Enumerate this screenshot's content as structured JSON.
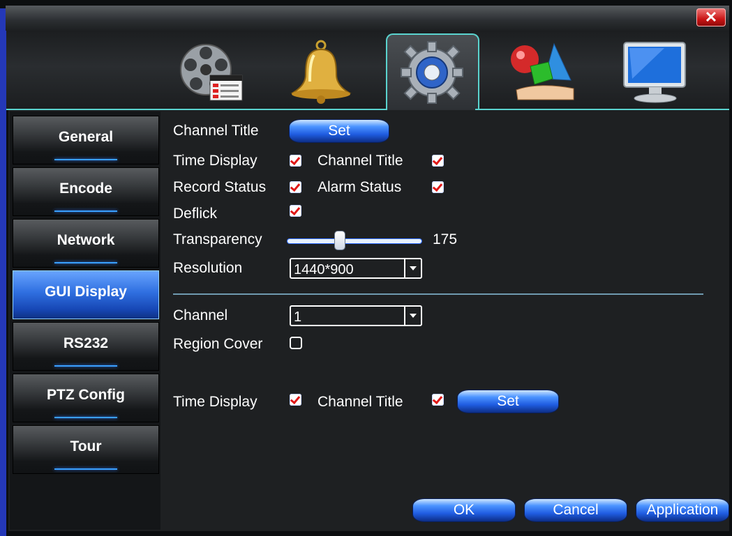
{
  "window": {
    "close_label": "✕"
  },
  "tabs": [
    {
      "icon": "record-film-icon"
    },
    {
      "icon": "alarm-bell-icon"
    },
    {
      "icon": "system-gear-icon",
      "active": true
    },
    {
      "icon": "advanced-shapes-icon"
    },
    {
      "icon": "info-monitor-icon"
    }
  ],
  "sidebar": {
    "items": [
      {
        "label": "General"
      },
      {
        "label": "Encode"
      },
      {
        "label": "Network"
      },
      {
        "label": "GUI Display",
        "active": true
      },
      {
        "label": "RS232"
      },
      {
        "label": "PTZ Config"
      },
      {
        "label": "Tour"
      }
    ]
  },
  "gui": {
    "channel_title_label": "Channel Title",
    "channel_title_set": "Set",
    "time_display_label": "Time Display",
    "time_display_checked": true,
    "channel_title_chk_label": "Channel Title",
    "channel_title_checked": true,
    "record_status_label": "Record Status",
    "record_status_checked": true,
    "alarm_status_label": "Alarm Status",
    "alarm_status_checked": true,
    "deflick_label": "Deflick",
    "deflick_checked": true,
    "transparency_label": "Transparency",
    "transparency_value": "175",
    "transparency_fraction": 0.38,
    "resolution_label": "Resolution",
    "resolution_value": "1440*900",
    "channel_label": "Channel",
    "channel_value": "1",
    "region_cover_label": "Region Cover",
    "region_cover_checked": false,
    "ch_time_display_label": "Time Display",
    "ch_time_display_checked": true,
    "ch_channel_title_label": "Channel Title",
    "ch_channel_title_checked": true,
    "ch_set": "Set"
  },
  "footer": {
    "ok": "OK",
    "cancel": "Cancel",
    "apply": "Application"
  },
  "colors": {
    "accent": "#5ad4cf",
    "button_blue": "#1f5ce0",
    "check_red": "#e01818",
    "close_red": "#c91414"
  }
}
